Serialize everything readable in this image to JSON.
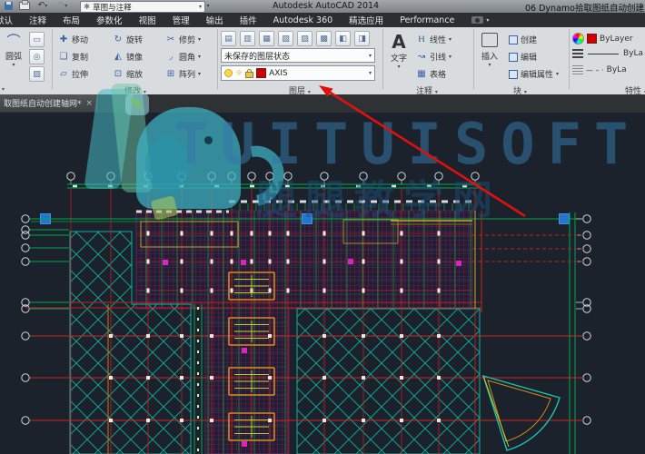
{
  "titlebar": {
    "workspace": "草图与注释",
    "app_title": "Autodesk AutoCAD 2014",
    "doc_title": "06 Dynamo拾取图纸自动创建"
  },
  "menu_tabs": {
    "partial_first": "默认",
    "tabs": [
      "注释",
      "布局",
      "参数化",
      "视图",
      "管理",
      "输出",
      "插件",
      "Autodesk 360",
      "精选应用",
      "Performance"
    ]
  },
  "ribbon": {
    "draw": {
      "arc": "圆弧"
    },
    "modify": {
      "label": "修改",
      "tools": [
        "移动",
        "旋转",
        "修剪",
        "复制",
        "镜像",
        "圆角",
        "拉伸",
        "缩放",
        "阵列"
      ]
    },
    "layers": {
      "label": "图层",
      "state": "未保存的图层状态",
      "current_layer": "AXIS",
      "current_layer_color": "#cc0000"
    },
    "annotate": {
      "label": "注释",
      "text": "文字",
      "linear": "线性",
      "leader": "引线",
      "table": "表格"
    },
    "block": {
      "label": "块",
      "insert": "插入",
      "create": "创建",
      "edit": "编辑",
      "edit_attr": "编辑属性"
    },
    "properties": {
      "label": "特性",
      "color": "ByLayer",
      "lineweight": "ByLa",
      "linetype": "ByLa"
    }
  },
  "file_tab": {
    "name": "取图纸自动创建轴网*",
    "close": "×"
  },
  "watermark": {
    "line1": "TUITUISOFT",
    "line2": "腿腿教学网"
  },
  "drawing": {
    "background": "#1b222b",
    "axis_green": "#00a84f",
    "gridline_red": "#c02020",
    "hatch_cyan": "#0fae9e",
    "dense_purple": "#8a1f8c",
    "marker_blue": "#2176d2",
    "marker_magenta": "#e020c0",
    "stair_orange": "#d4891c",
    "annotation_arrow_red": "#e01010"
  }
}
